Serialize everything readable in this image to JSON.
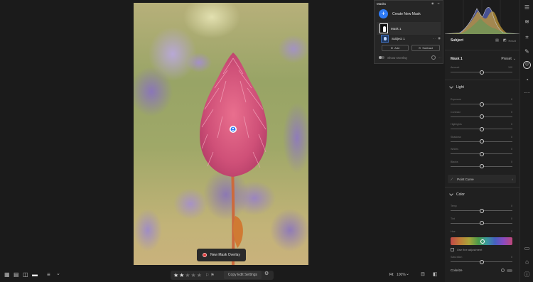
{
  "masks_panel": {
    "title": "Masks",
    "create_new_mask": "Create New Mask",
    "mask1_label": "Mask 1",
    "subject1_label": "Subject 1",
    "add_label": "Add",
    "subtract_label": "Subtract",
    "show_overlay_label": "Show Overlay"
  },
  "canvas": {
    "overlay_pill_label": "New Mask Overlay"
  },
  "right_panel": {
    "subject_label": "Subject",
    "reset_label": "Reset",
    "mask_name": "Mask 1",
    "preset_label": "Preset",
    "amount": {
      "label": "Amount",
      "value": "100"
    },
    "light_section": "Light",
    "light_sliders": [
      {
        "label": "Exposure",
        "value": "0",
        "pos": 0.5
      },
      {
        "label": "Contrast",
        "value": "0",
        "pos": 0.5
      },
      {
        "label": "Highlights",
        "value": "0",
        "pos": 0.5
      },
      {
        "label": "Shadows",
        "value": "0",
        "pos": 0.5
      },
      {
        "label": "Whites",
        "value": "0",
        "pos": 0.5
      },
      {
        "label": "Blacks",
        "value": "0",
        "pos": 0.5
      }
    ],
    "point_curve_label": "Point Curve",
    "color_section": "Color",
    "color_sliders": [
      {
        "label": "Temp",
        "value": "0",
        "pos": 0.5
      },
      {
        "label": "Tint",
        "value": "0",
        "pos": 0.5
      }
    ],
    "hue_label": "Hue",
    "hue_value": "0",
    "use_fine_adjustment": "Use fine adjustment",
    "saturation": {
      "label": "Saturation",
      "value": "0",
      "pos": 0.5
    },
    "colorize_label": "Colorize"
  },
  "bottom_bar": {
    "rating": 2,
    "rating_max": 5,
    "copy_edit_settings": "Copy Edit Settings",
    "fit_label": "Fit",
    "zoom_label": "100%"
  },
  "colors": {
    "accent": "#2e7bf6",
    "flower": "#d65a7c",
    "overlay_dot": "#e03b3b"
  }
}
